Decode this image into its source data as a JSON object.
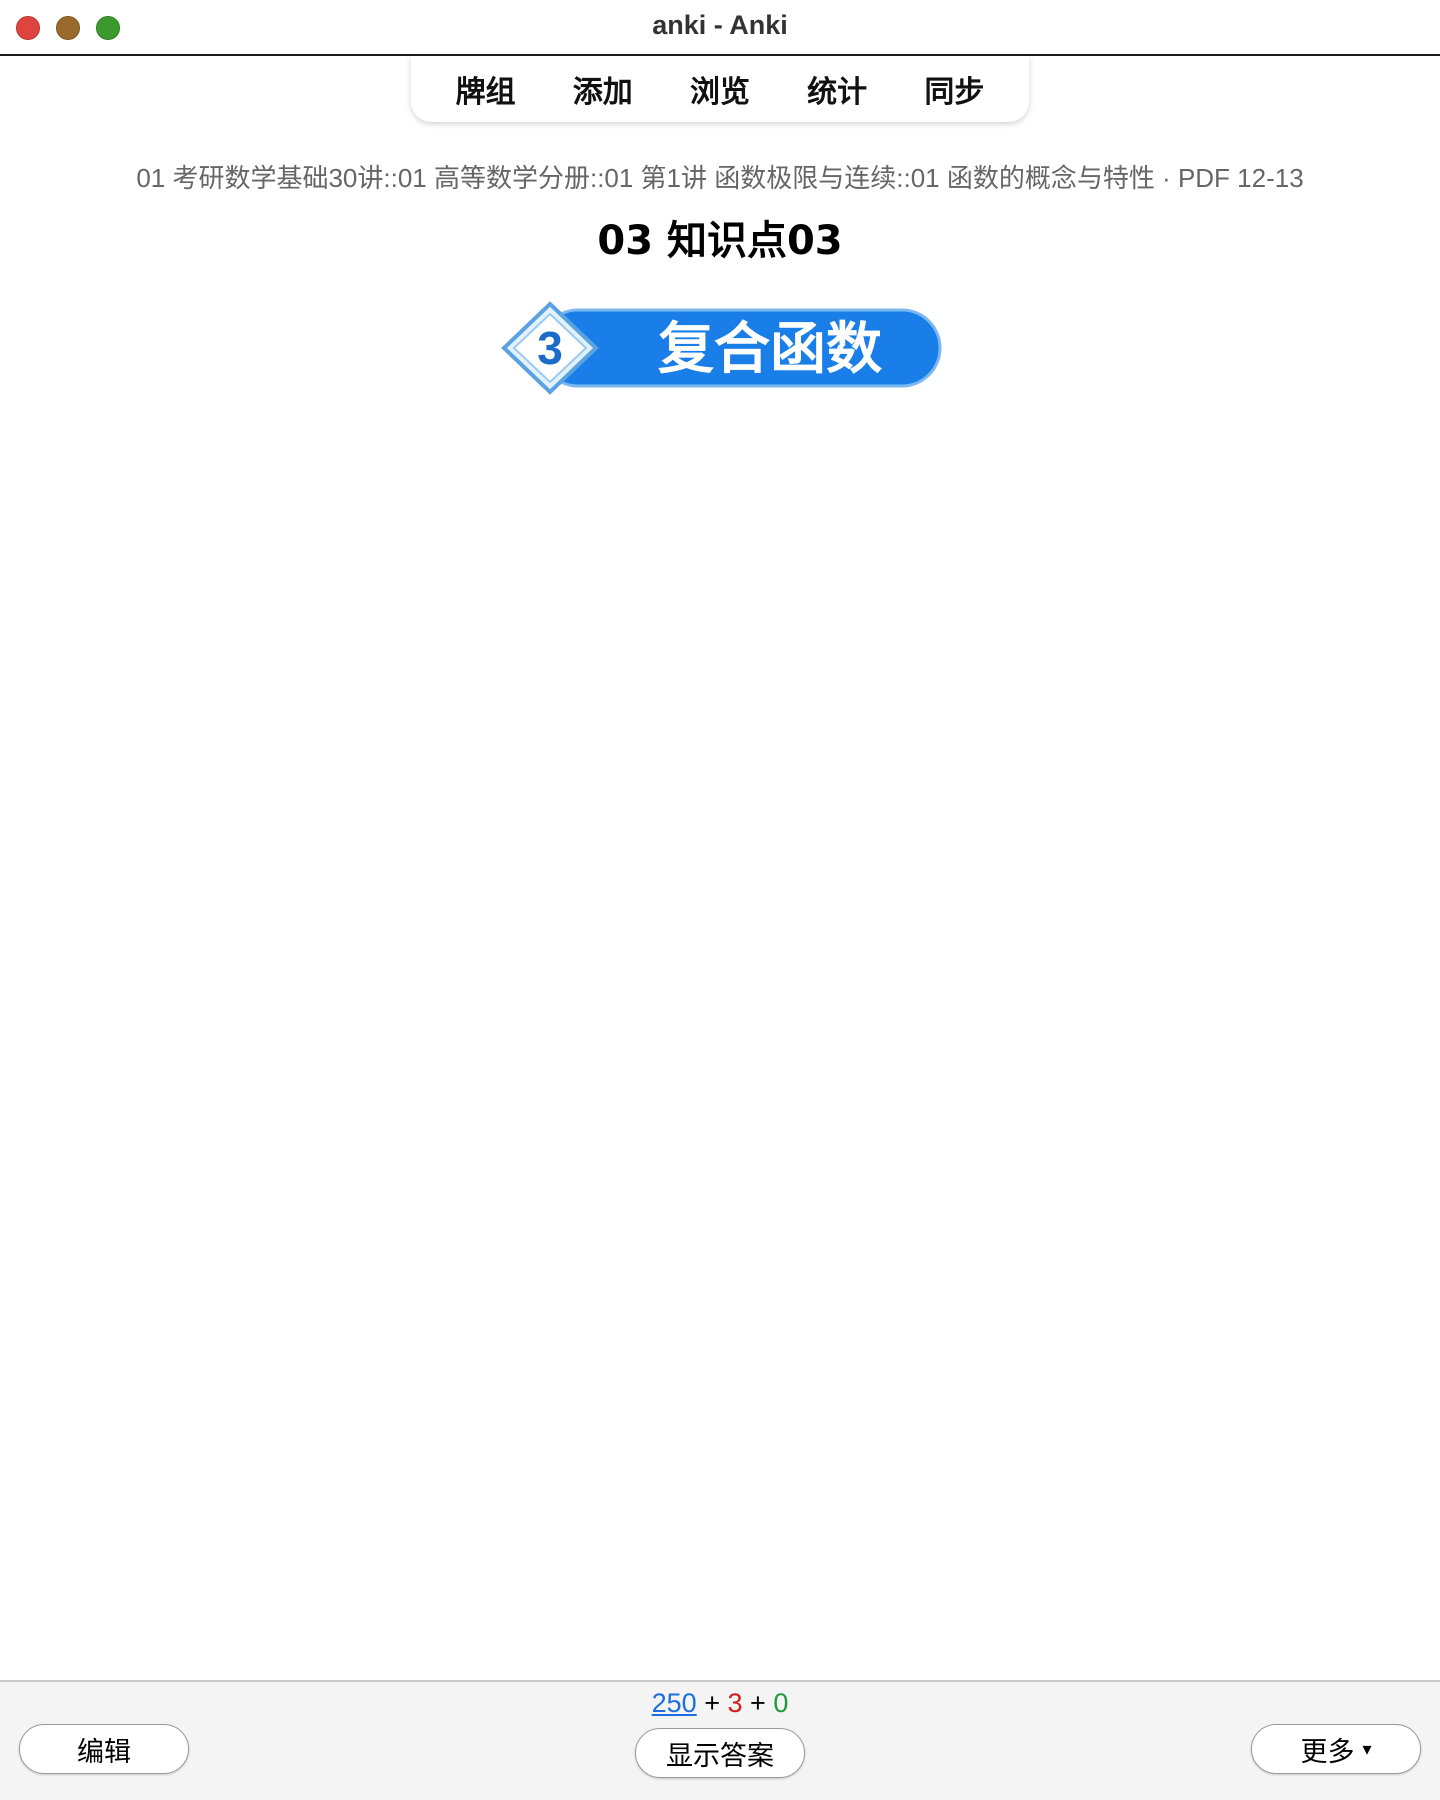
{
  "window": {
    "title": "anki - Anki"
  },
  "toolbar": {
    "items": [
      {
        "label": "牌组"
      },
      {
        "label": "添加"
      },
      {
        "label": "浏览"
      },
      {
        "label": "统计"
      },
      {
        "label": "同步"
      }
    ]
  },
  "card": {
    "deck_path": "01 考研数学基础30讲::01 高等数学分册::01 第1讲 函数极限与连续::01 函数的概念与特性 · PDF 12-13",
    "title": "03 知识点03",
    "image": {
      "badge_number": "3",
      "heading": "复合函数",
      "colors": {
        "badge": "#1a7ee8",
        "text": "#ffffff"
      }
    }
  },
  "bottombar": {
    "counts": {
      "new": "250",
      "learn": "3",
      "review": "0",
      "separator": "+"
    },
    "edit_label": "编辑",
    "show_answer_label": "显示答案",
    "more_label": "更多",
    "more_icon": "▾"
  }
}
